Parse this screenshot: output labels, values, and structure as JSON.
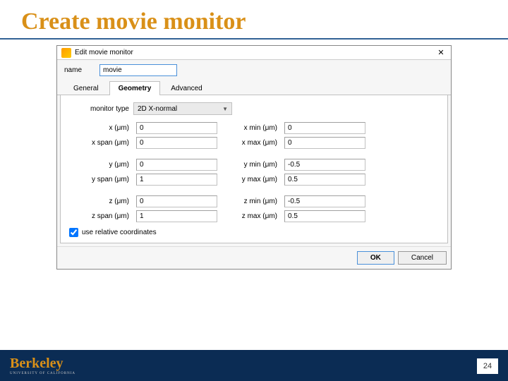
{
  "slide": {
    "title": "Create movie monitor"
  },
  "dialog": {
    "title": "Edit movie monitor",
    "name_label": "name",
    "name_value": "movie",
    "tabs": [
      "General",
      "Geometry",
      "Advanced"
    ],
    "active_tab": "Geometry",
    "monitor_type_label": "monitor type",
    "monitor_type_value": "2D X-normal",
    "fields": {
      "x_label": "x (μm)",
      "x_value": "0",
      "xspan_label": "x span (μm)",
      "xspan_value": "0",
      "xmin_label": "x min (μm)",
      "xmin_value": "0",
      "xmax_label": "x max (μm)",
      "xmax_value": "0",
      "y_label": "y (μm)",
      "y_value": "0",
      "yspan_label": "y span (μm)",
      "yspan_value": "1",
      "ymin_label": "y min (μm)",
      "ymin_value": "-0.5",
      "ymax_label": "y max (μm)",
      "ymax_value": "0.5",
      "z_label": "z (μm)",
      "z_value": "0",
      "zspan_label": "z span (μm)",
      "zspan_value": "1",
      "zmin_label": "z min (μm)",
      "zmin_value": "-0.5",
      "zmax_label": "z max (μm)",
      "zmax_value": "0.5"
    },
    "relative_label": "use relative coordinates",
    "ok": "OK",
    "cancel": "Cancel"
  },
  "footer": {
    "logo": "Berkeley",
    "logo_sub": "UNIVERSITY OF CALIFORNIA",
    "page": "24"
  }
}
